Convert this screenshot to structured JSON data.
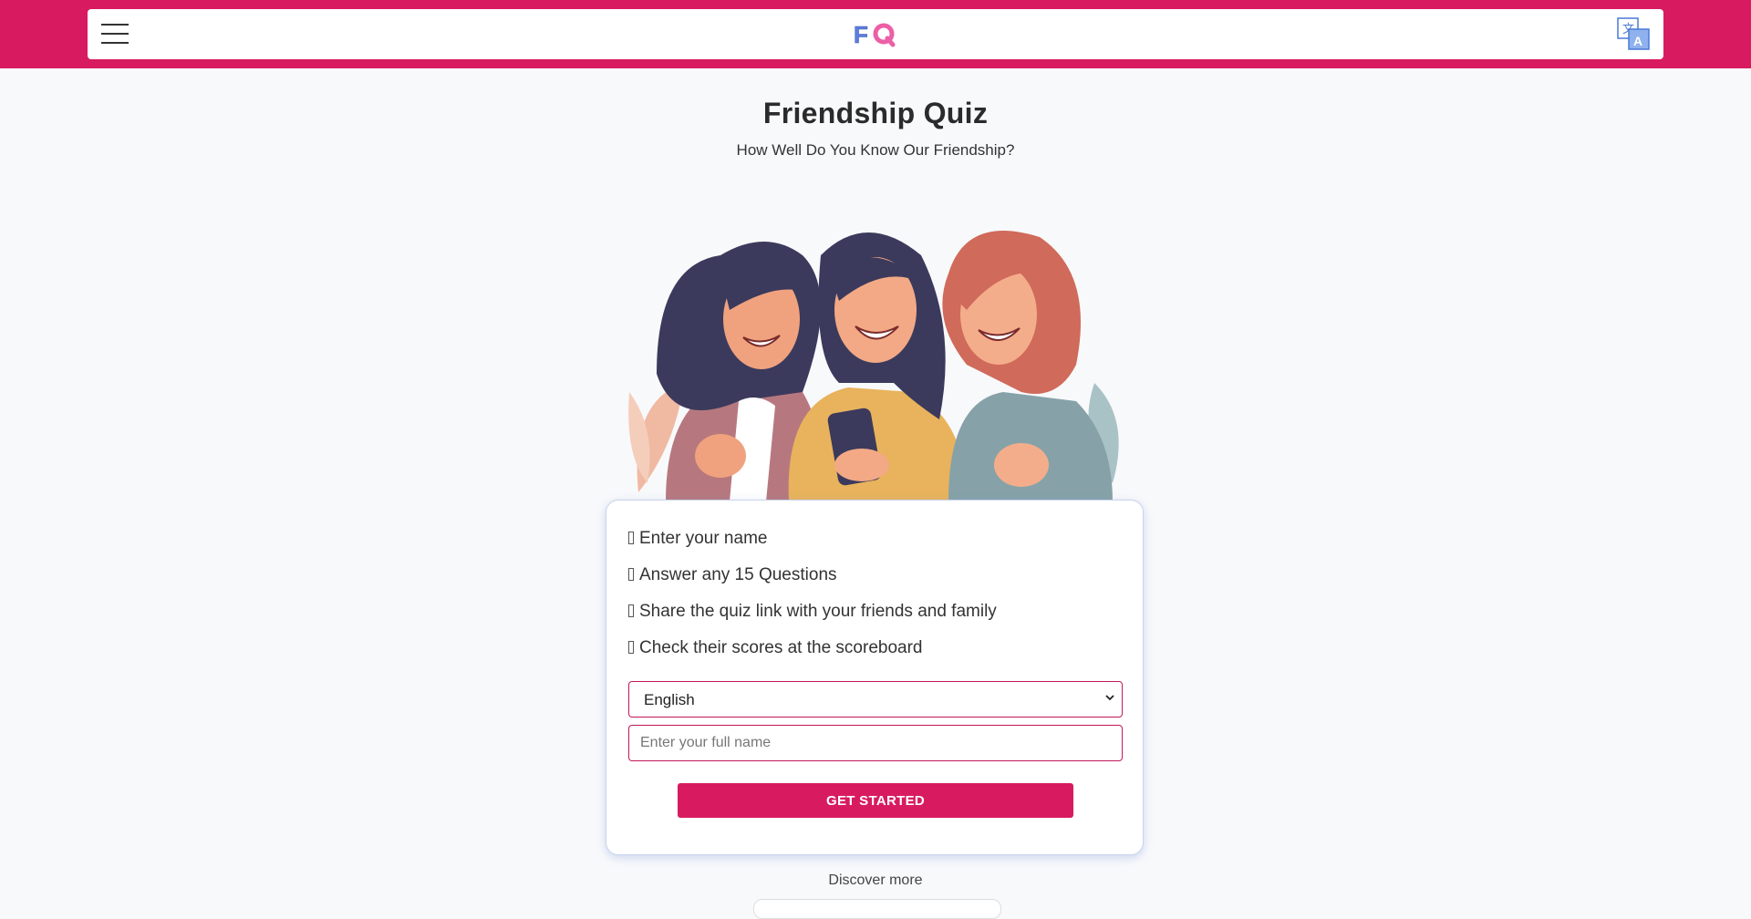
{
  "header": {
    "menu_icon": "hamburger-menu-icon",
    "logo_text": "FQ",
    "translate_icon": "translate-icon",
    "colors": {
      "brand": "#d81b60",
      "logo_blue": "#5b7fe0",
      "logo_pink": "#ec5fa6"
    }
  },
  "hero": {
    "title": "Friendship Quiz",
    "subtitle": "How Well Do You Know Our Friendship?"
  },
  "card": {
    "steps": [
      "Enter your name",
      "Answer any 15 Questions",
      "Share the quiz link with your friends and family",
      "Check their scores at the scoreboard"
    ],
    "language_select": {
      "selected": "English"
    },
    "name_input": {
      "placeholder": "Enter your full name",
      "value": ""
    },
    "start_button": "GET STARTED"
  },
  "footer": {
    "discover_label": "Discover more"
  }
}
